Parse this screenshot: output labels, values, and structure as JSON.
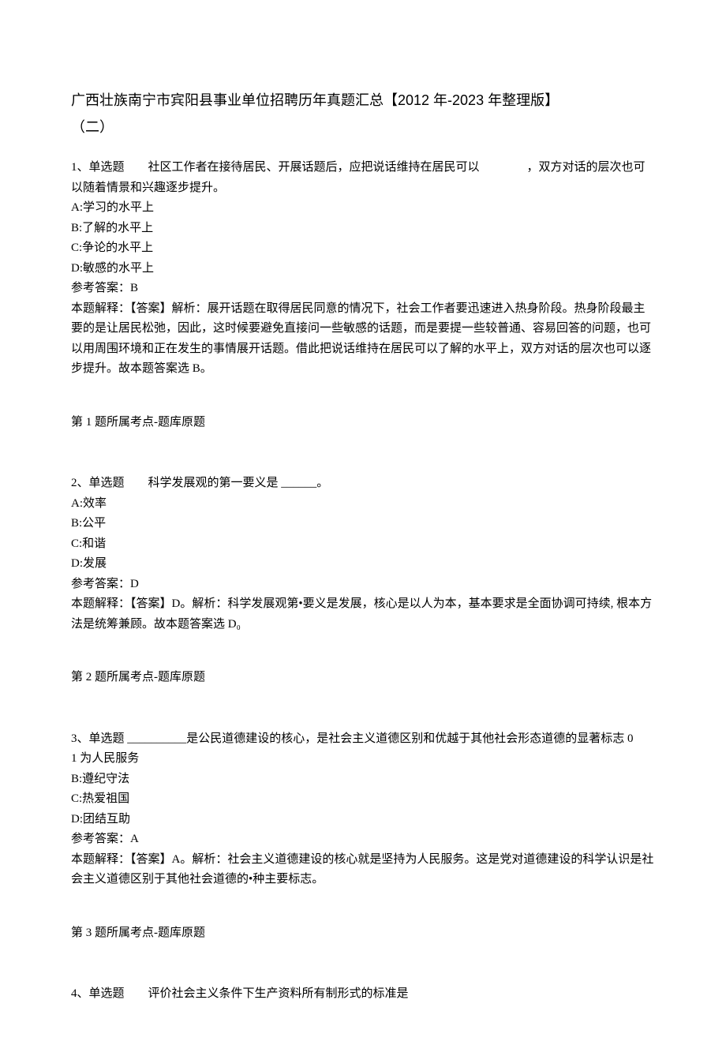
{
  "title_line1": "广西壮族南宁市宾阳县事业单位招聘历年真题汇总【2012 年-2023 年整理版】",
  "title_line2": "（二）",
  "q1": {
    "stem": "1、单选题　　社区工作者在接待居民、开展话题后，应把说话维持在居民可以　　　　，双方对话的层次也可以随着情景和兴趣逐步提升。",
    "optA": "A:学习的水平上",
    "optB": "B:了解的水平上",
    "optC": "C:争论的水平上",
    "optD": "D:敏感的水平上",
    "answer": "参考答案：B",
    "explain": "本题解释：【答案】解析：展开话题在取得居民同意的情况下，社会工作者要迅速进入热身阶段。热身阶段最主要的是让居民松弛，因此，这时候要避免直接问一些敏感的话题，而是要提一些较普通、容易回答的问题，也可以用周围环境和正在发生的事情展开话题。借此把说话维持在居民可以了解的水平上，双方对话的层次也可以逐步提升。故本题答案选 B。",
    "footer": "第 1 题所属考点-题库原题"
  },
  "q2": {
    "stem": "2、单选题　　科学发展观的第一要义是 ______。",
    "optA": "A:效率",
    "optB": "B:公平",
    "optC": "C:和谐",
    "optD": "D:发展",
    "answer": "参考答案：D",
    "explain": "本题解释：【答案】D。解析：科学发展观第•要义是发展，核心是以人为本，基本要求是全面协调可持续, 根本方法是统筹兼顾。故本题答案选 D₀",
    "footer": "第 2 题所属考点-题库原题"
  },
  "q3": {
    "stem": "3、单选题 __________是公民道德建设的核心，是社会主义道德区别和优越于其他社会形态道德的显著标志 0",
    "optA": "1 为人民服务",
    "optB": "B:遵纪守法",
    "optC": "C:热爱祖国",
    "optD": "D:团结互助",
    "answer": "参考答案：A",
    "explain": "本题解释：【答案】A。解析：社会主义道德建设的核心就是坚持为人民服务。这是党对道德建设的科学认识是社会主义道德区别于其他社会道德的•种主要标志。",
    "footer": "第 3 题所属考点-题库原题"
  },
  "q4": {
    "stem": "4、单选题　　评价社会主义条件下生产资料所有制形式的标准是"
  }
}
